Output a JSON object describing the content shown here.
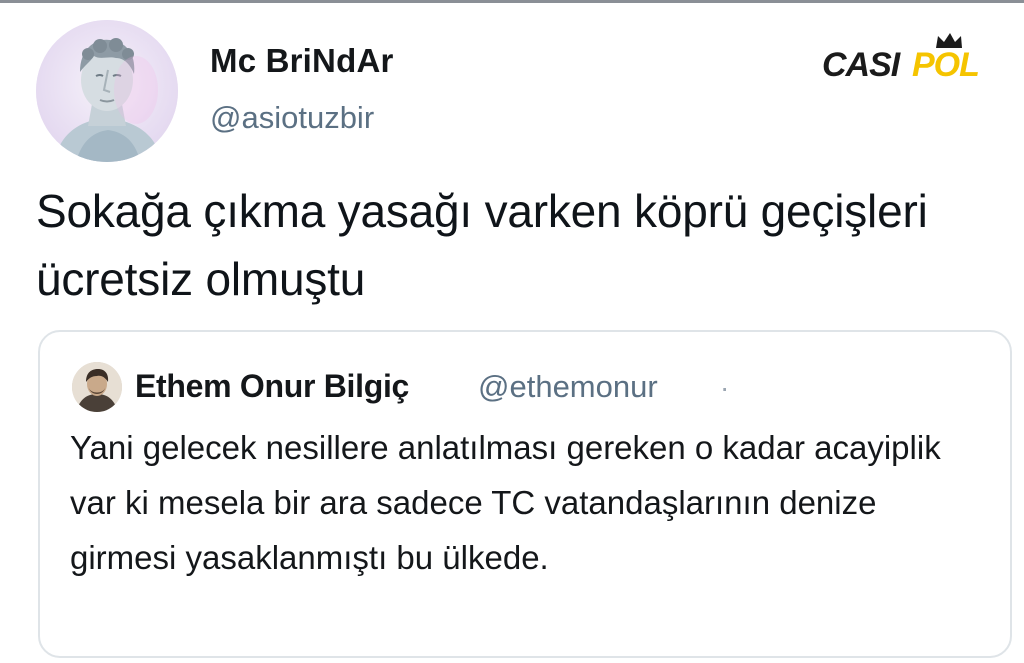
{
  "tweet": {
    "author": {
      "display_name": "Mc BriNdAr",
      "handle": "@asiotuzbir",
      "avatar": "statue-bust-avatar"
    },
    "text": "Sokağa çıkma yasağı varken köprü geçişleri ücretsiz olmuştu"
  },
  "quoted_tweet": {
    "author": {
      "display_name": "Ethem Onur Bilgiç",
      "handle": "@ethemonur",
      "avatar": "person-avatar"
    },
    "separator": "·",
    "text": "Yani gelecek nesillere anlatılması gereken o kadar acayiplik var ki mesela bir ara sadece TC vatandaşlarının denize girmesi yasaklanmıştı bu ülkede."
  },
  "watermark": {
    "text": "CASIPOL",
    "colors": {
      "dark": "#1b1b1b",
      "accent": "#f5c400"
    }
  }
}
